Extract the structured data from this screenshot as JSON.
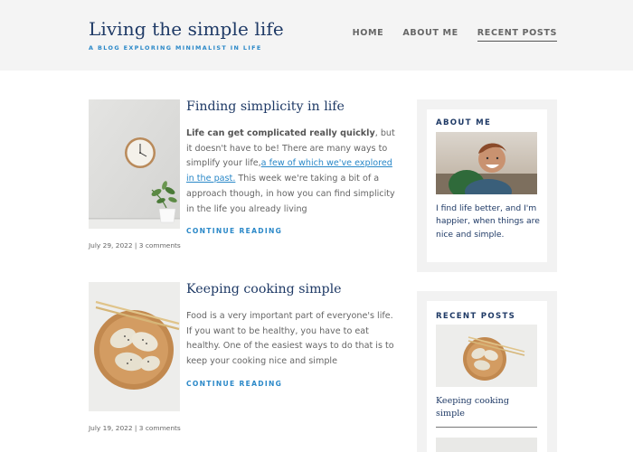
{
  "site": {
    "title": "Living the simple life",
    "tagline": "A BLOG EXPLORING MINIMALIST IN LIFE"
  },
  "nav": {
    "items": [
      {
        "label": "HOME",
        "active": false
      },
      {
        "label": "ABOUT ME",
        "active": false
      },
      {
        "label": "RECENT POSTS",
        "active": true
      }
    ]
  },
  "posts": [
    {
      "title": "Finding simplicity in life",
      "excerpt_bold": "Life can get complicated really quickly",
      "excerpt_part1": ", but it doesn't have to be! There are many ways to simplify your life,",
      "excerpt_link": "a few of which we've explored in the past.",
      "excerpt_part2": " This week we're taking a bit of a approach though, in how you can find simplicity in the life you already living",
      "continue_label": "CONTINUE READING",
      "date": "July 29, 2022",
      "comments": "3 comments",
      "image": "wall-clock-and-plant"
    },
    {
      "title": "Keeping cooking simple",
      "excerpt": "Food is a very important part of everyone's life. If you want to be healthy, you have to eat healthy. One of the easiest ways to do that is to keep your cooking nice and simple",
      "continue_label": "CONTINUE READING",
      "date": "July 19, 2022",
      "comments": "3 comments",
      "image": "dumplings-with-chopsticks"
    }
  ],
  "sidebar": {
    "about": {
      "heading": "ABOUT ME",
      "text": "I find life better, and I'm happier, when things are nice and simple.",
      "image": "laughing-person-photo"
    },
    "recent": {
      "heading": "RECENT POSTS",
      "items": [
        {
          "title": "Keeping cooking simple",
          "image": "dumplings-with-chopsticks"
        }
      ]
    }
  },
  "colors": {
    "title_navy": "#1f3a66",
    "accent_blue": "#2a88c8",
    "header_bg": "#f4f4f4",
    "sidebar_bg": "#f2f2f2"
  }
}
